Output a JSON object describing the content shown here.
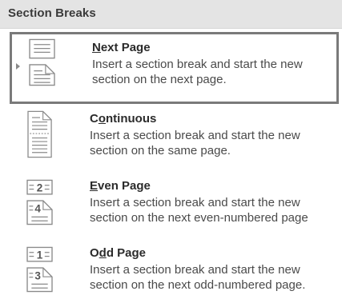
{
  "header": {
    "title": "Section Breaks"
  },
  "items": [
    {
      "key": "next_page",
      "title_prefix": "",
      "title_mnemonic": "N",
      "title_rest": "ext Page",
      "description": "Insert a section break and start the new\nsection on the next page.",
      "selected": true,
      "icon": "next-page-break-icon"
    },
    {
      "key": "continuous",
      "title_prefix": "C",
      "title_mnemonic": "o",
      "title_rest": "ntinuous",
      "description": "Insert a section break and start the new\nsection on the same page.",
      "selected": false,
      "icon": "continuous-break-icon"
    },
    {
      "key": "even_page",
      "title_prefix": "",
      "title_mnemonic": "E",
      "title_rest": "ven Page",
      "description": "Insert a section break and start the new\nsection on the next even-numbered page",
      "selected": false,
      "icon": "even-page-break-icon",
      "icon_numbers": [
        "2",
        "4"
      ]
    },
    {
      "key": "odd_page",
      "title_prefix": "O",
      "title_mnemonic": "d",
      "title_rest": "d Page",
      "description": "Insert a section break and start the new\nsection on the next odd-numbered page.",
      "selected": false,
      "icon": "odd-page-break-icon",
      "icon_numbers": [
        "1",
        "3"
      ]
    }
  ],
  "colors": {
    "header_bg": "#e4e4e4",
    "selection_border": "#7a7a7a",
    "text": "#4a4a4a"
  }
}
